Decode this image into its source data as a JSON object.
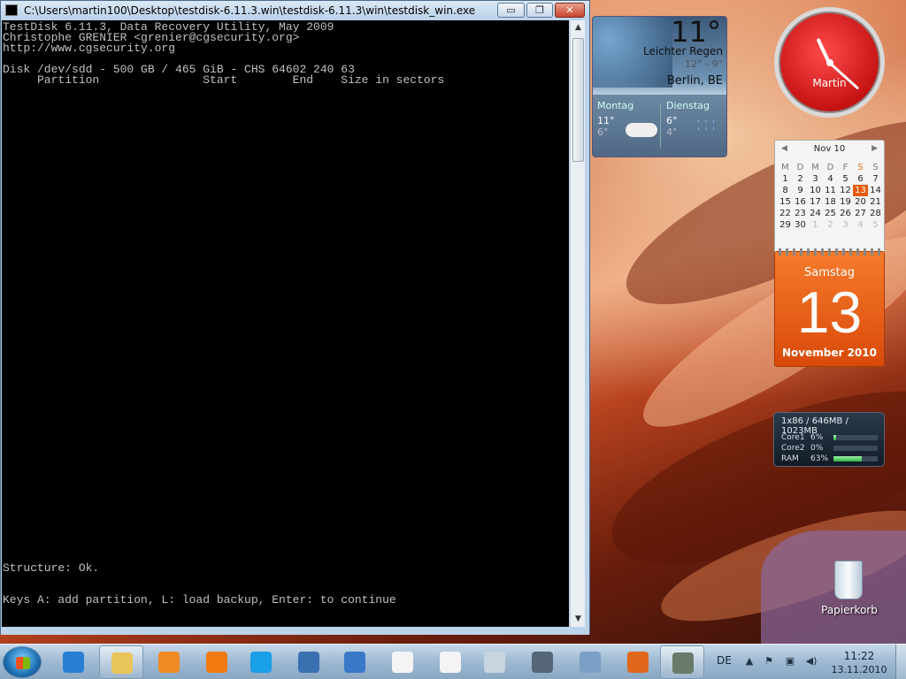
{
  "console_window": {
    "title": "C:\\Users\\martin100\\Desktop\\testdisk-6.11.3.win\\testdisk-6.11.3\\win\\testdisk_win.exe",
    "minimize_label": "▭",
    "maximize_label": "❐",
    "close_label": "✕",
    "lines": {
      "l1": "TestDisk 6.11.3, Data Recovery Utility, May 2009",
      "l2": "Christophe GRENIER <grenier@cgsecurity.org>",
      "l3": "http://www.cgsecurity.org",
      "l4": "Disk /dev/sdd - 500 GB / 465 GiB - CHS 64602 240 63",
      "l5": "     Partition               Start        End    Size in sectors",
      "l6": "Structure: Ok.",
      "l7": "Keys A: add partition, L: load backup, Enter: to continue"
    }
  },
  "weather": {
    "temperature": "11°",
    "condition": "Leichter Regen",
    "range": "12° -  9°",
    "city": "Berlin, BE",
    "forecast": [
      {
        "day": "Montag",
        "high": "11°",
        "low": "6°",
        "icon": "cloud-icon"
      },
      {
        "day": "Dienstag",
        "high": "6°",
        "low": "4°",
        "icon": "rain-icon"
      }
    ]
  },
  "clock": {
    "owner": "Martin",
    "hour_angle": 335,
    "minute_angle": 132
  },
  "calendar": {
    "month_label": "Nov 10",
    "weekdays": [
      "M",
      "D",
      "M",
      "D",
      "F",
      "S",
      "S"
    ],
    "weeks": [
      [
        "1",
        "2",
        "3",
        "4",
        "5",
        "6",
        "7"
      ],
      [
        "8",
        "9",
        "10",
        "11",
        "12",
        "13",
        "14"
      ],
      [
        "15",
        "16",
        "17",
        "18",
        "19",
        "20",
        "21"
      ],
      [
        "22",
        "23",
        "24",
        "25",
        "26",
        "27",
        "28"
      ],
      [
        "29",
        "30",
        "1",
        "2",
        "3",
        "4",
        "5"
      ]
    ],
    "today": "13",
    "day_name": "Samstag",
    "day_number": "13",
    "month_year": "November 2010"
  },
  "cpu_meter": {
    "header": "1x86 / 646MB / 1023MB",
    "rows": [
      {
        "label": "Core1",
        "value": "6%",
        "fraction": 0.06
      },
      {
        "label": "Core2",
        "value": "0%",
        "fraction": 0.0
      },
      {
        "label": "RAM",
        "value": "63%",
        "fraction": 0.63
      }
    ]
  },
  "desktop": {
    "recycle_bin_label": "Papierkorb"
  },
  "taskbar": {
    "items": [
      {
        "name": "taskbar-internet-explorer",
        "color": "#2a7fd4"
      },
      {
        "name": "taskbar-explorer",
        "color": "#e8c45a"
      },
      {
        "name": "taskbar-media-player",
        "color": "#f08a24"
      },
      {
        "name": "taskbar-vlc",
        "color": "#f07a10"
      },
      {
        "name": "taskbar-skype",
        "color": "#1aa0e8"
      },
      {
        "name": "taskbar-network-app",
        "color": "#3a6fb0"
      },
      {
        "name": "taskbar-thunderbird",
        "color": "#3a78c8"
      },
      {
        "name": "taskbar-notepad-1",
        "color": "#f4f4f4"
      },
      {
        "name": "taskbar-notepad-2",
        "color": "#f4f4f4"
      },
      {
        "name": "taskbar-wintv",
        "color": "#c8d4e0"
      },
      {
        "name": "taskbar-satellite",
        "color": "#556677"
      },
      {
        "name": "taskbar-network-monitor",
        "color": "#7aa0c8"
      },
      {
        "name": "taskbar-firefox",
        "color": "#e0671c"
      },
      {
        "name": "taskbar-testdisk",
        "color": "#6a7a6a"
      }
    ],
    "language": "DE",
    "time": "11:22",
    "date": "13.11.2010"
  }
}
